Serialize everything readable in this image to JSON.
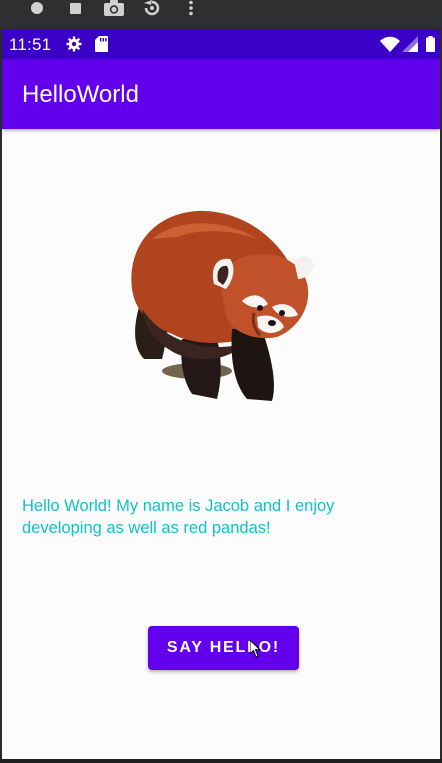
{
  "emulator_toolbar": {
    "icons": [
      "record-dot-icon",
      "stop-square-icon",
      "camera-icon",
      "rotate-icon",
      "more-vert-icon"
    ]
  },
  "status_bar": {
    "time": "11:51",
    "icons": [
      "gear-icon",
      "sd-card-icon",
      "wifi-icon",
      "signal-icon",
      "battery-icon"
    ]
  },
  "app_bar": {
    "title": "HelloWorld"
  },
  "main": {
    "image_description": "red-panda",
    "message": "Hello World! My name is Jacob and I enjoy developing as well as red pandas!",
    "button_label": "SAY HELLO!"
  },
  "colors": {
    "primary": "#6200ee",
    "primary_dark": "#3a00c7",
    "text_accent": "#11c2c9",
    "background": "#fcfcfc"
  }
}
